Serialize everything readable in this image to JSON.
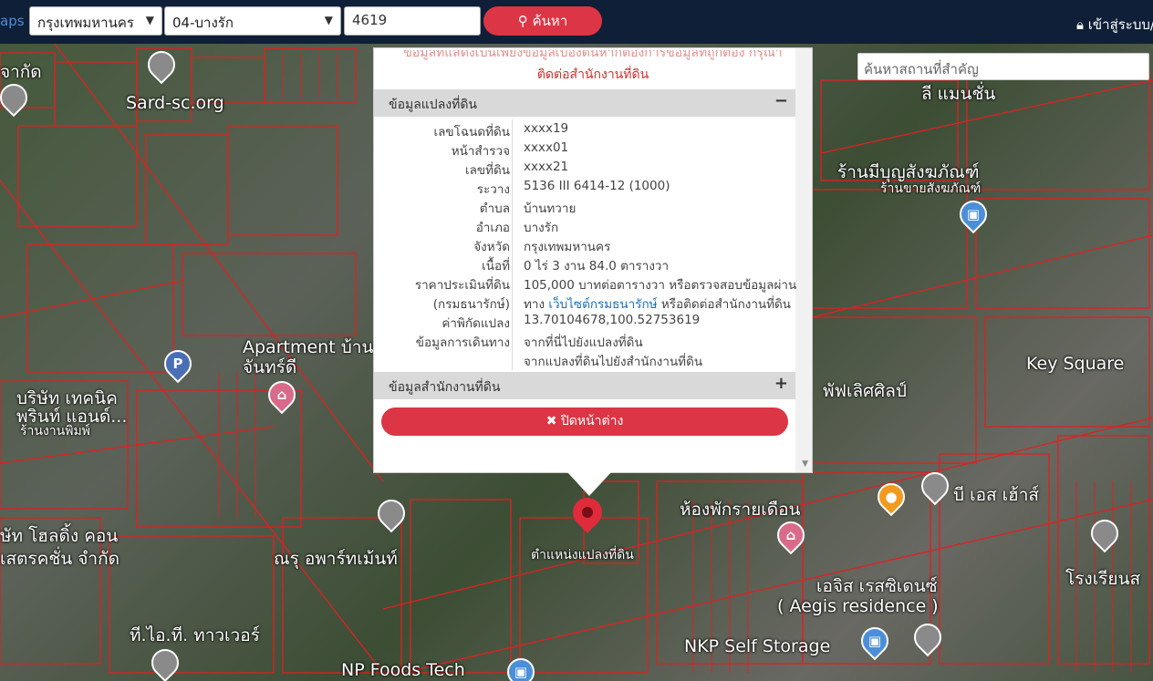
{
  "topbar": {
    "brand": "aps",
    "province": "กรุงเทพมหานคร",
    "district": "04-บางรัก",
    "parcel_no": "4619",
    "search_label": "ค้นหา",
    "login_label": "เข้าสู่ระบบ/"
  },
  "place_search": {
    "placeholder": "ค้นหาสถานที่สำคัญ"
  },
  "popup": {
    "notice_line1": "ข้อมูลที่แสดงเป็นเพียงข้อมูลเบื้องต้นหากต้องการข้อมูลที่ถูกต้อง กรุณา",
    "notice_line2": "ติดต่อสำนักงานที่ดิน",
    "section1_title": "ข้อมูลแปลงที่ดิน",
    "section1_toggle": "−",
    "rows": [
      {
        "k": "เลขโฉนดที่ดิน",
        "v": "xxxx19"
      },
      {
        "k": "หน้าสำรวจ",
        "v": "xxxx01"
      },
      {
        "k": "เลขที่ดิน",
        "v": "xxxx21"
      },
      {
        "k": "ระวาง",
        "v": "5136 III 6414-12 (1000)"
      },
      {
        "k": "ตำบล",
        "v": "บ้านทวาย"
      },
      {
        "k": "อำเภอ",
        "v": "บางรัก"
      },
      {
        "k": "จังหวัด",
        "v": "กรุงเทพมหานคร"
      },
      {
        "k": "เนื้อที่",
        "v": "0 ไร่ 3 งาน 84.0 ตารางวา"
      },
      {
        "k": "ราคาประเมินที่ดิน",
        "v": "105,000 บาทต่อตารางวา หรือตรวจสอบข้อมูลผ่าน"
      },
      {
        "k": "(กรมธนารักษ์)",
        "v_pre": "ทาง ",
        "v_link": "เว็บไซต์กรมธนารักษ์",
        "v_post": " หรือติดต่อสำนักงานที่ดิน"
      },
      {
        "k": "ค่าพิกัดแปลง",
        "v": "13.70104678,100.52753619"
      },
      {
        "k": "ข้อมูลการเดินทาง",
        "v": "จากที่นี่ไปยังแปลงที่ดิน"
      },
      {
        "k": "",
        "v": "จากแปลงที่ดินไปยังสำนักงานที่ดิน"
      }
    ],
    "section2_title": "ข้อมูลสำนักงานที่ดิน",
    "section2_toggle": "+",
    "close_label": "ปิดหน้าต่าง"
  },
  "map": {
    "marker_label": "ตำแหน่งแปลงที่ดิน",
    "labels": [
      "Sard-sc.org",
      "Apartment บ้าน",
      "จันทร์ดี",
      "บริษัท เทคนิค",
      "พรินท์ แอนด์...",
      "ร้านงานพิมพ์",
      "ษัท โฮลดิ้ง คอน",
      "เสตรคชั่น จำกัด",
      "ณรุ อพาร์ทเม้นท์",
      "ที.ไอ.ที. ทาวเวอร์",
      "NP Foods Tech",
      "NKP Self Storage",
      "เอจิส เรสซิเดนซ์",
      "( Aegis residence )",
      "ห้องพักรายเดือน",
      "บี เอส เฮ้าส์",
      "ร้านมีบุญสังฆภัณฑ์",
      "ร้านขายสังฆภัณฑ์",
      "Key Square",
      "พัฟเลิศศิลป์",
      "โรงเรียนส",
      "จากัด",
      "ลี แมนชั่น"
    ]
  },
  "colors": {
    "accent": "#dc3545",
    "navbar": "#0f1f38",
    "parcel": "#e02020"
  }
}
